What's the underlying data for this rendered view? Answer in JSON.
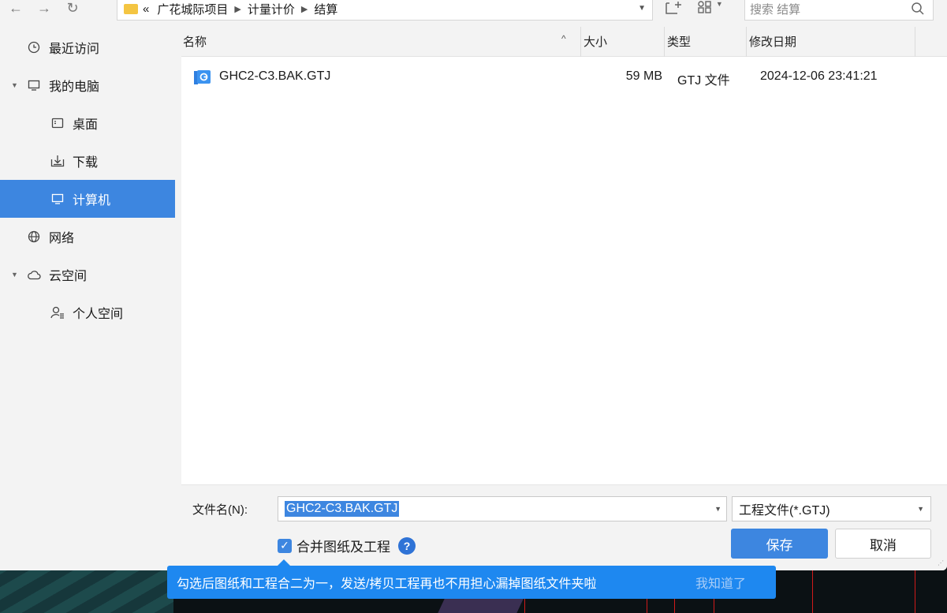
{
  "toolbar": {
    "back_icon": "arrow-left-icon",
    "forward_icon": "arrow-right-icon",
    "refresh_icon": "refresh-icon",
    "breadcrumb_prefix": "«",
    "breadcrumb": [
      "广花城际项目",
      "计量计价",
      "结算"
    ],
    "search_placeholder": "搜索 结算"
  },
  "sidebar": {
    "items": [
      {
        "label": "最近访问",
        "icon": "clock-icon"
      },
      {
        "label": "我的电脑",
        "icon": "monitor-icon"
      },
      {
        "label": "桌面",
        "icon": "desktop-icon"
      },
      {
        "label": "下载",
        "icon": "download-icon"
      },
      {
        "label": "计算机",
        "icon": "computer-icon"
      },
      {
        "label": "网络",
        "icon": "globe-icon"
      },
      {
        "label": "云空间",
        "icon": "cloud-icon"
      },
      {
        "label": "个人空间",
        "icon": "user-icon"
      }
    ]
  },
  "filelist": {
    "columns": {
      "name": "名称",
      "size": "大小",
      "type": "类型",
      "date": "修改日期"
    },
    "files": [
      {
        "name": "GHC2-C3.BAK.GTJ",
        "size": "59 MB",
        "type": "GTJ 文件",
        "date": "2024-12-06 23:41:21"
      }
    ]
  },
  "bottom": {
    "filename_label": "文件名(N):",
    "filename_value": "GHC2-C3.BAK.GTJ",
    "filetype_value": "工程文件(*.GTJ)",
    "merge_label": "合并图纸及工程",
    "help_glyph": "?",
    "save_label": "保存",
    "cancel_label": "取消"
  },
  "tooltip": {
    "message": "勾选后图纸和工程合二为一，发送/拷贝工程再也不用担心漏掉图纸文件夹啦",
    "dismiss_label": "我知道了"
  },
  "colors": {
    "accent": "#3d86e0",
    "tooltip_bg": "#1e88f0"
  }
}
